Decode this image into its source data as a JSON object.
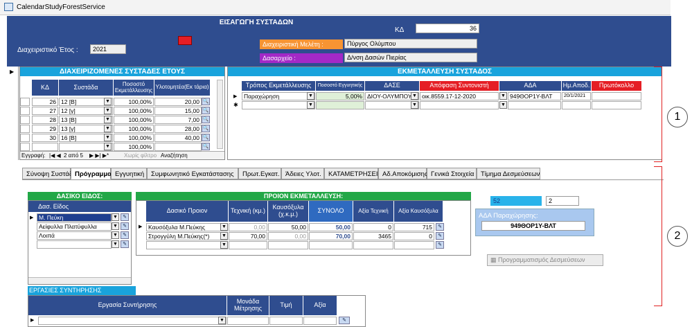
{
  "window": {
    "title": "CalendarStudyForestService"
  },
  "header": {
    "title": "ΕΙΣΑΓΩΓΗ ΣΥΣΤΑΔΩΝ",
    "kd_label": "ΚΔ",
    "kd_value": "36",
    "year_label": "Διαχειριστικό Έτος :",
    "year_value": "2021",
    "study_label": "Διαχειριστική Μελέτη :",
    "study_value": "Πύργος Ολύμπου",
    "office_label": "Δασαρχείο :",
    "office_value": "Δ/νση Δασών Πιερίας"
  },
  "stands": {
    "title": "ΔΙΑΧΕΙΡΙΖΟΜΕΝΕΣ ΣΥΣΤΑΔΕΣ ΕΤΟΥΣ",
    "cols": [
      "ΚΔ",
      "Συστάδα",
      "Ποσοστό Εκμετάλλευσης",
      "Υλοτομητέα(Εκ τάρια)"
    ],
    "rows": [
      [
        "26",
        "12 [Β]",
        "100,00%",
        "20,00"
      ],
      [
        "27",
        "12 [γ]",
        "100,00%",
        "15,00"
      ],
      [
        "28",
        "13 [Β]",
        "100,00%",
        "7,00"
      ],
      [
        "29",
        "13 [γ]",
        "100,00%",
        "28,00"
      ],
      [
        "30",
        "16 [Β]",
        "100,00%",
        "40,00"
      ],
      [
        "",
        "",
        "100,00%",
        ""
      ]
    ],
    "nav": {
      "record": "Εγγραφή:",
      "pos": "2 από 5",
      "filter": "Χωρίς φίλτρο",
      "search": "Αναζήτηση"
    }
  },
  "exploit": {
    "title": "ΕΚΜΕΤΑΛΛΕΥΣΗ ΣΥΣΤΑΔΟΣ",
    "cols": [
      "Τρόπος Εκμετάλλευσης",
      "Ποσοστό Εγγυητικής",
      "ΔΑΣΕ",
      "Απόφαση Συντονιστή",
      "ΑΔΑ",
      "Ημ.Αποδ.",
      "Πρωτόκολλο"
    ],
    "rows": [
      [
        "Παραχώρηση",
        "5,00%",
        "ΔΙΟΥ-ΟΛΥΜΠΟΥ",
        "οικ.8559.17-12-2020",
        "949ΘΟΡ1Υ-ΒΛΤ",
        "20/1/2021",
        ""
      ]
    ]
  },
  "tabs": [
    "Σύνοψη Συστάδας",
    "Πρόγραμμα",
    "Εγγυητική",
    "Συμφωνητικό Εγκατάστασης",
    "Πρωτ.Εγκατ.",
    "Άδειες Υλοτ.",
    "ΚΑΤΑΜΕΤΡΗΣΕΙΣ",
    "Αδ.Αποκόμισης",
    "Γενικά Στοιχεία",
    "Τίμημα Δεσμεύσεων"
  ],
  "species": {
    "title": "ΔΑΣΙΚΟ ΕΙΔΟΣ:",
    "col": "Δασ. Είδος",
    "rows": [
      "Μ. Πεύκη",
      "Αείφυλλα Πλατύφυλλα",
      "Λοιπά",
      ""
    ]
  },
  "product": {
    "title": "ΠΡΟΙΟΝ ΕΚΜΕΤΑΛΛΕΥΣΗ:",
    "cols": [
      "Δασικό Προιον",
      "Τεχνική (κμ.)",
      "Καυσόξυλα (χ.κ.μ.)",
      "ΣΥΝΟΛΟ",
      "Αξία Τεχνική",
      "Αξία Καυσόξυλα"
    ],
    "rows": [
      [
        "Καυσόξυλα Μ.Πεύκης",
        "0,00",
        "50,00",
        "50,00",
        "0",
        "715"
      ],
      [
        "Στρογγύλη Μ.Πεύκης(*)",
        "70,00",
        "0,00",
        "70,00",
        "3465",
        "0"
      ],
      [
        "",
        "",
        "",
        "",
        "",
        ""
      ]
    ]
  },
  "side": {
    "field1": "52",
    "field2": "2",
    "ada_label": "ΑΔΑ Παραχώρησης:",
    "ada_value": "949ΘΟΡ1Υ-ΒΛΤ",
    "schedule_button": "Προγραμματισμός Δεσμεύσεων"
  },
  "maintenance": {
    "title": "ΕΡΓΑΣΙΕΣ ΣΥΝΤΗΡΗΣΗΣ",
    "cols": [
      "Εργασία Συντήρησης",
      "Μονάδα Μέτρησης",
      "Τιμή",
      "Αξία"
    ]
  },
  "annotations": {
    "one": "1",
    "two": "2"
  },
  "colors": {
    "header": "#2f4d8f",
    "band_blue": "#19a3dc",
    "band_green": "#22a747",
    "red": "#e51e25",
    "orange": "#f79433",
    "purple": "#a329c7"
  }
}
